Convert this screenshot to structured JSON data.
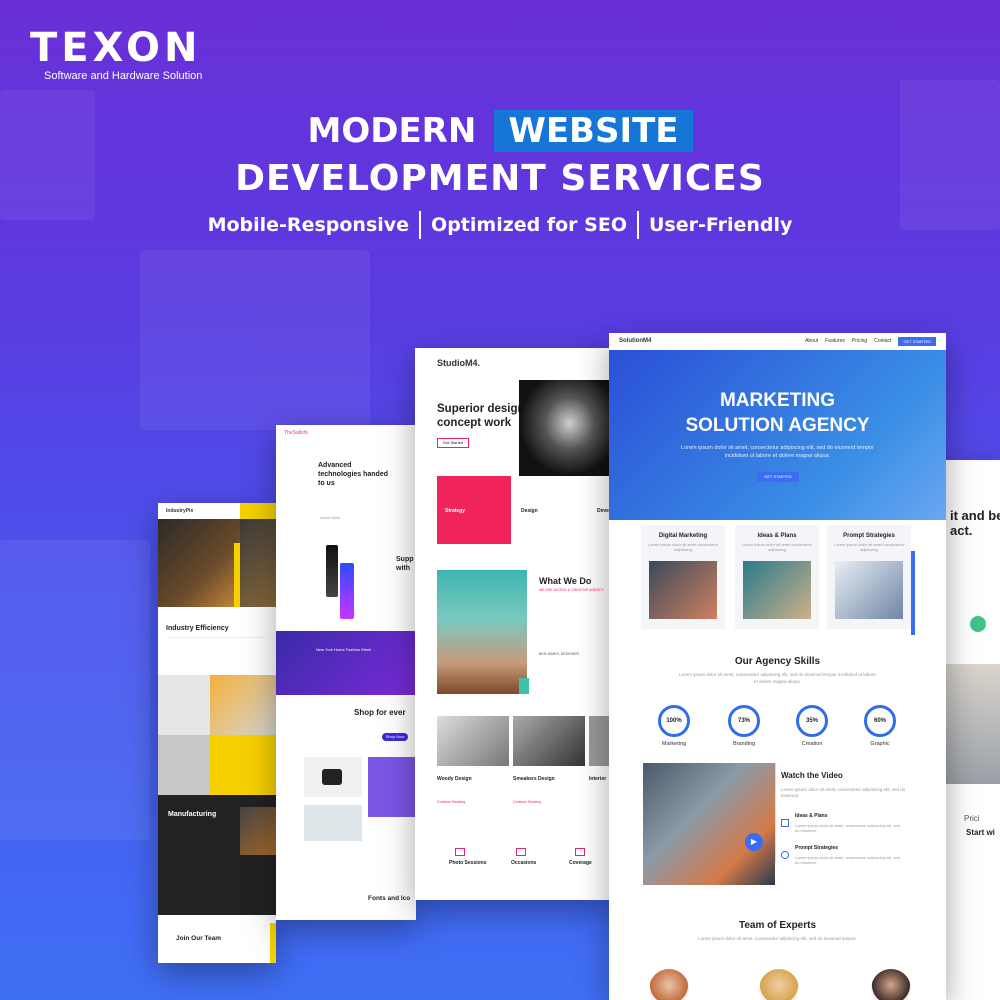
{
  "brand": {
    "logo_text": "TEXON",
    "tagline": "Software and Hardware Solution"
  },
  "headline": {
    "line1_prefix": "MODERN",
    "line1_highlight": "WEBSITE",
    "line2": "DEVELOPMENT SERVICES",
    "features": [
      "Mobile-Responsive",
      "Optimized for SEO",
      "User-Friendly"
    ]
  },
  "colors": {
    "highlight": "#1576d8",
    "accent_blue": "#2f6cf0",
    "accent_pink": "#f0245a",
    "accent_yellow": "#f6d000"
  },
  "mock_industry": {
    "brand": "IndustryPix",
    "title": "Industry Efficiency",
    "section2": "Manufacturing",
    "footer": "Join Our Team"
  },
  "mock_fashion": {
    "brand": "TheSaltshi",
    "hero": "Advanced technologies handed to us",
    "learn": "Learn More",
    "supp": "Supp with",
    "banner": "New York Home Fashion Week",
    "shop": "Shop for ever",
    "shop_btn": "Shop Now",
    "fonts": "Fonts and Ico"
  },
  "mock_studio": {
    "brand": "StudioM4.",
    "hero": "Superior design & concept work",
    "cta": "Get Started",
    "service1": "Strategy",
    "service2": "Design",
    "service3": "Deve",
    "what_title": "What We Do",
    "what_sub": "WE ARE DIGITAL & CREATIVE AGENCY",
    "signature": "BEN JAMES, DESIGNER",
    "post1": "Woody Design",
    "post2": "Smeakers Design",
    "post3": "Interior",
    "read": "Continue Reading",
    "icon1": "Photo Sessions",
    "icon2": "Occasions",
    "icon3": "Coverage"
  },
  "mock_solution": {
    "brand": "SolutionM4",
    "nav": [
      "About",
      "Features",
      "Pricing",
      "Contact"
    ],
    "nav_cta": "GET STARTED",
    "hero_title_1": "MARKETING",
    "hero_title_2": "SOLUTION AGENCY",
    "hero_sub": "Lorem ipsum dolor sit amet, consectetur adipiscing elit, sed do eiusmod tempor incididunt ut labore et dolore magna aliqua.",
    "hero_btn": "GET STARTED",
    "cards": [
      "Digital Marketing",
      "Ideas & Plans",
      "Prompt Strategies"
    ],
    "card_text": "Lorem ipsum dolor sit amet consectetur adipiscing",
    "skills_title": "Our Agency Skills",
    "skills_sub": "Lorem ipsum dolor sit amet, consectetur adipiscing elit, sed do eiusmod tempor incididunt ut labore et dolore magna aliqua.",
    "skills": [
      {
        "value": "100%",
        "label": "Marketing"
      },
      {
        "value": "73%",
        "label": "Branding"
      },
      {
        "value": "35%",
        "label": "Creation"
      },
      {
        "value": "60%",
        "label": "Graphic"
      }
    ],
    "video_title": "Watch the Video",
    "video_text": "Lorem ipsum dolor sit amet, consectetur adipiscing elit, sed do eiusmod.",
    "feature1": "Ideas & Plans",
    "feature2": "Prompt Strategies",
    "team_title": "Team of Experts",
    "team_sub": "Lorem ipsum dolor sit amet, consectetur adipiscing elit, sed do eiusmod tempor."
  },
  "mock_right": {
    "title": "it and be act.",
    "pricing": "Prici",
    "start": "Start wi"
  }
}
